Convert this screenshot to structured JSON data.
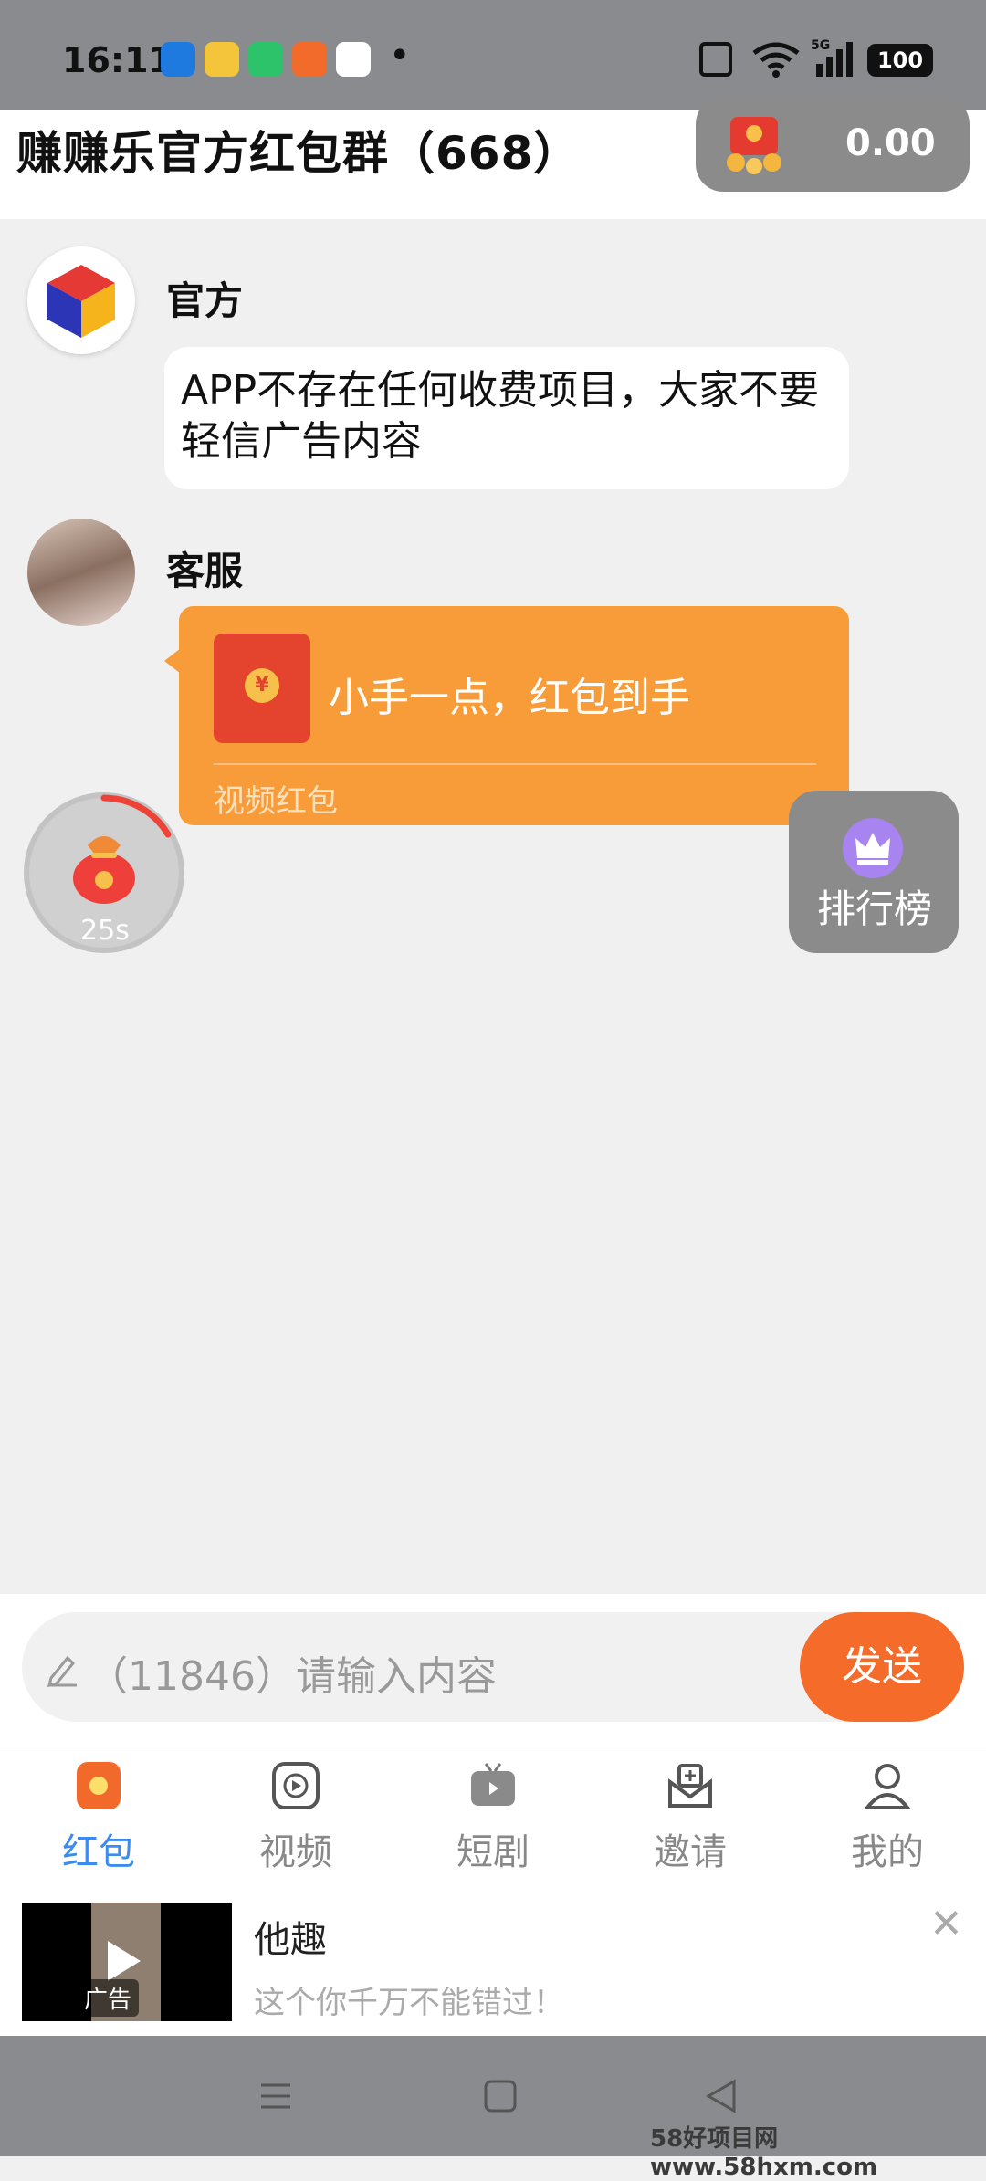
{
  "status_bar": {
    "time": "16:11",
    "battery": "100",
    "signal": "5G"
  },
  "header": {
    "title": "赚赚乐官方红包群（668）",
    "balance": "0.00"
  },
  "messages": {
    "official": {
      "sender": "官方",
      "text": "APP不存在任何收费项目，大家不要轻信广告内容"
    },
    "service": {
      "sender": "客服",
      "packet_text": "小手一点，红包到手",
      "packet_type": "视频红包",
      "coin_symbol": "¥"
    }
  },
  "floating": {
    "timer": "25s",
    "ranking": "排行榜"
  },
  "input": {
    "placeholder": "（11846）请输入内容",
    "send": "发送"
  },
  "nav": [
    {
      "label": "红包",
      "icon": "red-packet-icon",
      "active": true
    },
    {
      "label": "视频",
      "icon": "video-icon"
    },
    {
      "label": "短剧",
      "icon": "tv-icon"
    },
    {
      "label": "邀请",
      "icon": "invite-icon"
    },
    {
      "label": "我的",
      "icon": "profile-icon"
    }
  ],
  "ad": {
    "title": "他趣",
    "desc": "这个你千万不能错过！",
    "badge": "广告",
    "close": "✕"
  },
  "watermark": "58好项目网www.58hxm.com",
  "colors": {
    "accent_orange": "#f56b2a",
    "packet_orange": "#f89c3a",
    "nav_active": "#3b8cf0"
  }
}
